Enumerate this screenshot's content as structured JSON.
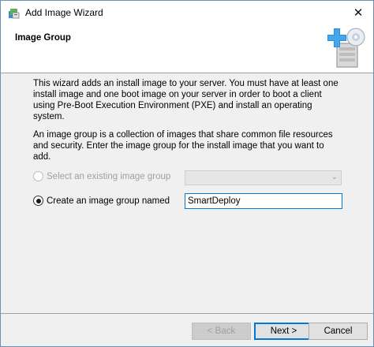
{
  "window": {
    "title": "Add Image Wizard",
    "close_glyph": "✕"
  },
  "header": {
    "title": "Image Group",
    "icon": "install-image-wizard-icon"
  },
  "content": {
    "intro": "This wizard adds an install image to your server. You must have at least one install image and one boot image on your server in order to boot a client using Pre-Boot Execution Environment (PXE) and install an operating system.",
    "group_desc": "An image group is a collection of images that share common file resources and security. Enter the image group for the install image that you want to add.",
    "option_existing": {
      "label": "Select an existing image group",
      "selected": false,
      "enabled": false,
      "value": ""
    },
    "option_new": {
      "label": "Create an image group named",
      "selected": true,
      "enabled": true,
      "value": "SmartDeploy"
    }
  },
  "buttons": {
    "back": "< Back",
    "next": "Next >",
    "cancel": "Cancel"
  },
  "colors": {
    "focus_blue": "#0078d7",
    "disabled_text": "#a0a0a0"
  }
}
